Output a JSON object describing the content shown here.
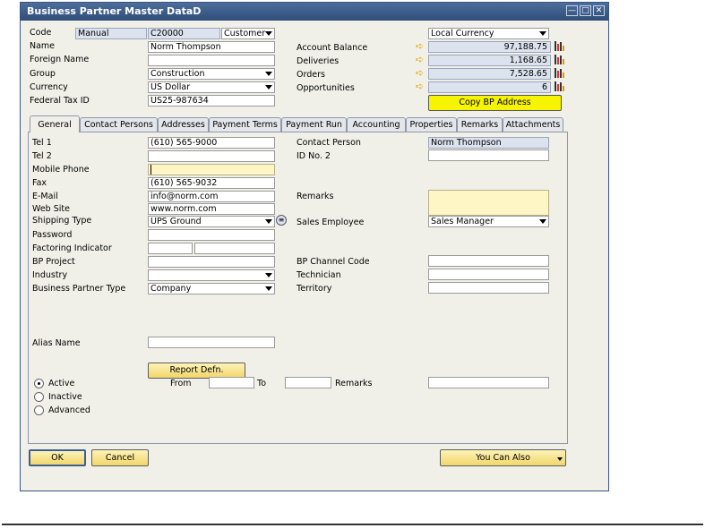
{
  "window": {
    "title": "Business Partner Master DataD",
    "min_glyph": "—",
    "max_glyph": "□",
    "close_glyph": "✕"
  },
  "header": {
    "code_label": "Code",
    "series_value": "Manual",
    "code_value": "C20000",
    "type_value": "Customer",
    "name_label": "Name",
    "name_value": "Norm Thompson",
    "foreign_name_label": "Foreign Name",
    "foreign_name_value": "",
    "group_label": "Group",
    "group_value": "Construction",
    "currency_label": "Currency",
    "currency_value": "US Dollar",
    "tax_id_label": "Federal Tax ID",
    "tax_id_value": "US25-987634",
    "currency_mode_value": "Local Currency",
    "account_balance_label": "Account Balance",
    "account_balance_value": "97,188.75",
    "deliveries_label": "Deliveries",
    "deliveries_value": "1,168.65",
    "orders_label": "Orders",
    "orders_value": "7,528.65",
    "opportunities_label": "Opportunities",
    "opportunities_value": "6",
    "copy_address_label": "Copy BP Address"
  },
  "tabs": [
    {
      "label": "General"
    },
    {
      "label": "Contact Persons"
    },
    {
      "label": "Addresses"
    },
    {
      "label": "Payment Terms"
    },
    {
      "label": "Payment Run"
    },
    {
      "label": "Accounting"
    },
    {
      "label": "Properties"
    },
    {
      "label": "Remarks"
    },
    {
      "label": "Attachments"
    }
  ],
  "general": {
    "tel1_label": "Tel 1",
    "tel1_value": "(610) 565-9000",
    "tel2_label": "Tel 2",
    "tel2_value": "",
    "mobile_label": "Mobile Phone",
    "mobile_value": "",
    "fax_label": "Fax",
    "fax_value": "(610) 565-9032",
    "email_label": "E-Mail",
    "email_value": "info@norm.com",
    "website_label": "Web Site",
    "website_value": "www.norm.com",
    "shipping_label": "Shipping Type",
    "shipping_value": "UPS Ground",
    "password_label": "Password",
    "password_value": "",
    "factoring_label": "Factoring Indicator",
    "bp_project_label": "BP Project",
    "bp_project_value": "",
    "industry_label": "Industry",
    "industry_value": "",
    "bp_type_label": "Business Partner Type",
    "bp_type_value": "Company",
    "contact_person_label": "Contact Person",
    "contact_person_value": "Norm Thompson",
    "id_no2_label": "ID No. 2",
    "id_no2_value": "",
    "remarks_label": "Remarks",
    "remarks_value": "",
    "sales_employee_label": "Sales Employee",
    "sales_employee_value": "Sales Manager",
    "channel_code_label": "BP Channel Code",
    "channel_code_value": "",
    "technician_label": "Technician",
    "technician_value": "",
    "territory_label": "Territory",
    "territory_value": "",
    "alias_label": "Alias Name",
    "alias_value": "",
    "report_defn_label": "Report Defn.",
    "active_label": "Active",
    "inactive_label": "Inactive",
    "advanced_label": "Advanced",
    "from_label": "From",
    "from_value": "",
    "to_label": "To",
    "to_value": "",
    "status_remarks_label": "Remarks",
    "status_remarks_value": ""
  },
  "footer": {
    "ok_label": "OK",
    "cancel_label": "Cancel",
    "you_can_also_label": "You Can Also"
  }
}
